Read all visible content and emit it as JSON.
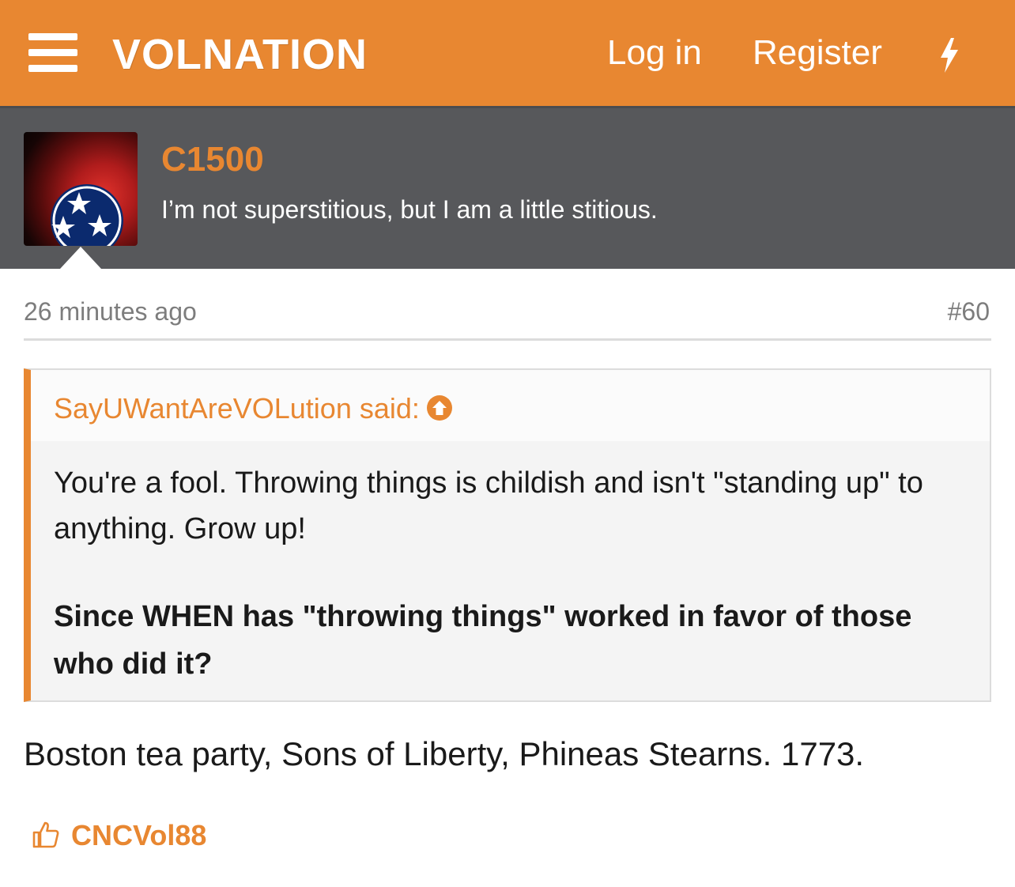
{
  "header": {
    "logo_text": "VolNation",
    "login_label": "Log in",
    "register_label": "Register",
    "menu_icon": "hamburger-menu-icon",
    "whats_new_icon": "lightning-bolt-icon",
    "brand_color": "#e88731"
  },
  "author": {
    "username": "C1500",
    "title": "I’m not superstitious, but I am a little stitious."
  },
  "post": {
    "time": "26 minutes ago",
    "number": "#60",
    "quote": {
      "attribution": "SayUWantAreVOLution said:",
      "text": "You're a fool. Throwing things is childish and isn't \"standing up\" to anything. Grow up!",
      "bold_text": "Since WHEN has \"throwing things\" worked in favor of those who did it?"
    },
    "reply": "Boston tea party, Sons of Liberty, Phineas Stearns. 1773.",
    "likes": {
      "icon": "thumbs-up-icon",
      "user": "CNCVol88"
    }
  }
}
